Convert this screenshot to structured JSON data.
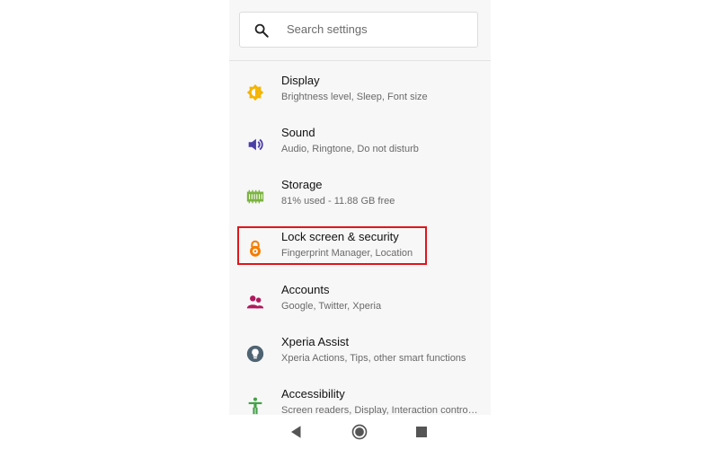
{
  "search": {
    "placeholder": "Search settings",
    "icon": "search-icon"
  },
  "items": [
    {
      "title": "Display",
      "subtitle": "Brightness level, Sleep, Font size",
      "icon": "brightness-icon",
      "color": "#f4b400"
    },
    {
      "title": "Sound",
      "subtitle": "Audio, Ringtone, Do not disturb",
      "icon": "volume-icon",
      "color": "#4b3fa7"
    },
    {
      "title": "Storage",
      "subtitle": "81% used - 11.88 GB free",
      "icon": "storage-chip-icon",
      "color": "#7cb342"
    },
    {
      "title": "Lock screen & security",
      "subtitle": "Fingerprint Manager, Location",
      "icon": "lock-icon",
      "color": "#f57c00",
      "highlighted": true
    },
    {
      "title": "Accounts",
      "subtitle": "Google, Twitter, Xperia",
      "icon": "accounts-icon",
      "color": "#b0195d"
    },
    {
      "title": "Xperia Assist",
      "subtitle": "Xperia Actions, Tips, other smart functions",
      "icon": "lightbulb-icon",
      "color": "#4f6473"
    },
    {
      "title": "Accessibility",
      "subtitle": "Screen readers, Display, Interaction contro…",
      "icon": "accessibility-icon",
      "color": "#43a047"
    }
  ],
  "highlight_color": "#e0151b",
  "navbar": {
    "buttons": [
      "back-icon",
      "home-icon",
      "recents-icon"
    ],
    "color": "#555555"
  }
}
